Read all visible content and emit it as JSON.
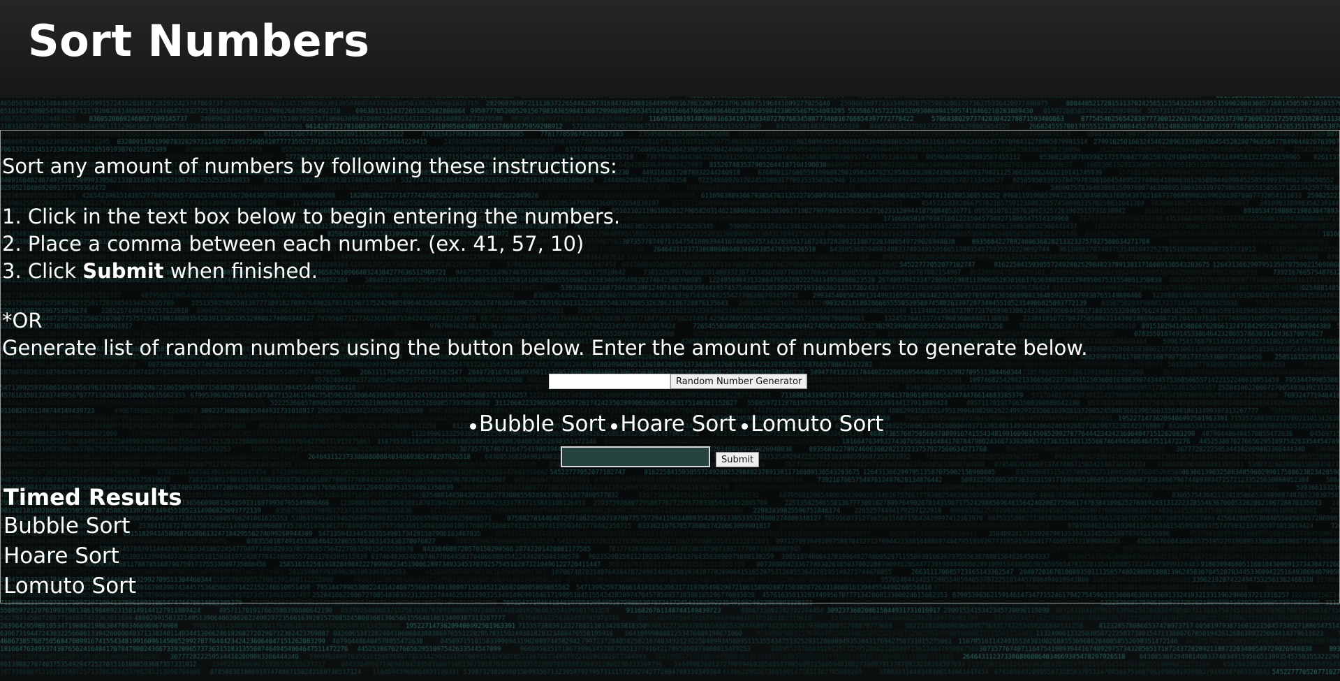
{
  "header": {
    "title": "Sort Numbers"
  },
  "instructions": {
    "intro": "Sort any amount of numbers by following these instructions:",
    "step1": "1. Click in the text box below to begin entering the numbers.",
    "step2": "2. Place a comma between each number. (ex. 41, 57, 10)",
    "step3_prefix": "3. Click ",
    "step3_bold": "Submit",
    "step3_suffix": " when finished.",
    "or": "*OR",
    "generate": "Generate list of random numbers using the button below. Enter the amount of numbers to generate below."
  },
  "generator": {
    "input_value": "",
    "button_label": "Random Number Generator"
  },
  "algorithms": [
    {
      "label": "Bubble Sort"
    },
    {
      "label": "Hoare Sort"
    },
    {
      "label": "Lomuto Sort"
    }
  ],
  "submit": {
    "input_value": "",
    "button_label": "Submit"
  },
  "results": {
    "title": "Timed Results",
    "items": [
      {
        "label": "Bubble Sort"
      },
      {
        "label": "Hoare Sort"
      },
      {
        "label": "Lomuto Sort"
      }
    ]
  },
  "colors": {
    "background": "#0b0f0f",
    "digits": "#2f7f78",
    "header": "#1f1f1f",
    "text": "#ffffff",
    "submit_box": "#25433f"
  }
}
